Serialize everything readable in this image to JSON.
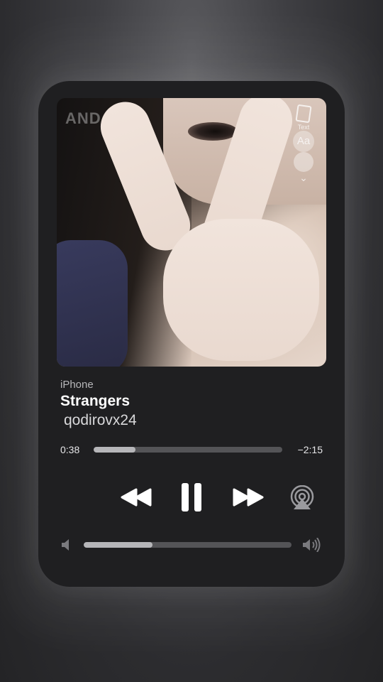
{
  "artwork": {
    "watermark": "AND",
    "side_icons": [
      {
        "name": "text-icon",
        "label": "Text"
      },
      {
        "name": "aa-icon",
        "label": "Aa"
      },
      {
        "name": "face-icon",
        "label": ""
      },
      {
        "name": "chevron-down-icon",
        "label": ""
      }
    ]
  },
  "player": {
    "source": "iPhone",
    "title": "Strangers",
    "artist": "qodirovx24",
    "elapsed": "0:38",
    "remaining": "−2:15",
    "progress_fraction": 0.22,
    "volume_fraction": 0.33
  },
  "controls": {
    "rewind_icon": "rewind-icon",
    "pause_icon": "pause-icon",
    "forward_icon": "fast-forward-icon",
    "airplay_icon": "airplay-icon"
  },
  "colors": {
    "card_background": "#1f1f21",
    "track": "#545457",
    "track_fill": "#b6b6b9",
    "text_primary": "#ffffff",
    "text_secondary": "#b7b7ba"
  }
}
